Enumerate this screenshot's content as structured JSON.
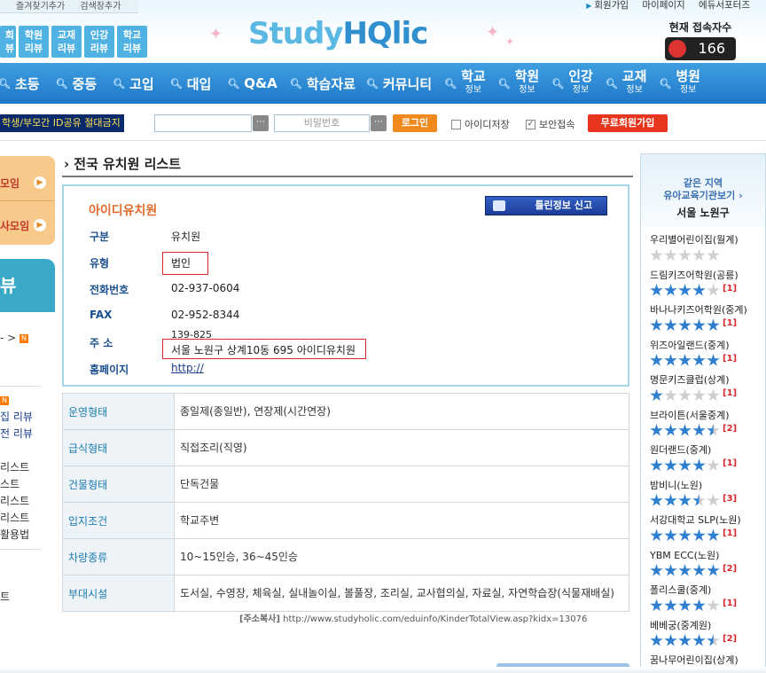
{
  "top_left_links": [
    "즐겨찾기추가",
    "검색창추가"
  ],
  "top_right_links": [
    "회원가입",
    "마이페이지",
    "에듀서포터즈"
  ],
  "mini_tabs": [
    {
      "l1": "회",
      "l2": "뷰"
    },
    {
      "l1": "학원",
      "l2": "리뷰"
    },
    {
      "l1": "교재",
      "l2": "리뷰"
    },
    {
      "l1": "인강",
      "l2": "리뷰"
    },
    {
      "l1": "학교",
      "l2": "리뷰"
    }
  ],
  "logo": {
    "part1": "Study",
    "part2": "HQlic"
  },
  "connected": {
    "label": "현재 접속자수",
    "count": "166"
  },
  "nav": {
    "items": [
      "초등",
      "중등",
      "고입",
      "대입",
      "Q&A",
      "학습자료",
      "커뮤니티"
    ],
    "two_line": [
      {
        "main": "학교",
        "sub": "정보"
      },
      {
        "main": "학원",
        "sub": "정보"
      },
      {
        "main": "인강",
        "sub": "정보"
      },
      {
        "main": "교재",
        "sub": "정보"
      },
      {
        "main": "병원",
        "sub": "정보"
      }
    ]
  },
  "login": {
    "warning": "학생/부모간 ID공유 절대금지",
    "id_placeholder": "",
    "pw_placeholder": "비밀번호",
    "login_btn": "로그인",
    "save_id": "아이디저장",
    "secure": "보안접속",
    "signup_btn": "무료회원가입"
  },
  "left": {
    "box_rows": [
      "모임",
      "사모임"
    ],
    "box2_text": "뷰",
    "list": [
      {
        "text": "- >",
        "blue": false,
        "new": true
      },
      {
        "text": "",
        "blue": false,
        "new": false
      },
      {
        "text": "",
        "blue": false,
        "new": false
      },
      {
        "text": "",
        "blue": false,
        "new": false
      },
      {
        "text": "",
        "blue": false,
        "new": true
      },
      {
        "text": "집 리뷰",
        "blue": true,
        "new": false
      },
      {
        "text": "전 리뷰",
        "blue": true,
        "new": false
      },
      {
        "text": "",
        "blue": true,
        "new": false
      },
      {
        "text": "리스트",
        "blue": false,
        "new": false
      },
      {
        "text": "스트",
        "blue": false,
        "new": false
      },
      {
        "text": "리스트",
        "blue": false,
        "new": false
      },
      {
        "text": "리스트",
        "blue": false,
        "new": false
      },
      {
        "text": "활용법",
        "blue": false,
        "new": false
      }
    ],
    "bottom": "트"
  },
  "page_title": "전국 유치원 리스트",
  "kinder": {
    "name": "아이디유치원",
    "report_btn": "틀린정보 신고",
    "rows": [
      {
        "label": "구분",
        "value": "유치원"
      },
      {
        "label": "유형",
        "value": "법인"
      },
      {
        "label": "전화번호",
        "value": "02-937-0604"
      },
      {
        "label": "FAX",
        "value": "02-952-8344"
      },
      {
        "label": "주 소",
        "zip": "139-825",
        "value": "서울 노원구 상계10동 695 아이디유치원"
      },
      {
        "label": "홈페이지",
        "value": "http://"
      }
    ]
  },
  "details": [
    {
      "label": "운영형태",
      "value": "종일제(종일반), 연장제(시간연장)"
    },
    {
      "label": "급식형태",
      "value": "직접조리(직영)"
    },
    {
      "label": "건물형태",
      "value": "단독건물"
    },
    {
      "label": "입지조건",
      "value": "학교주변"
    },
    {
      "label": "차량종류",
      "value": "10~15인승, 36~45인승"
    },
    {
      "label": "부대시설",
      "value": "도서실, 수영장, 체육실, 실내놀이실, 볼풀장, 조리실, 교사협의실, 자료실, 자연학습장(식물재배실)"
    }
  ],
  "address_copy": {
    "label": "[주소복사]",
    "url": "http://www.studyholic.com/eduinfo/KinderTotalView.asp?kidx=13076"
  },
  "right": {
    "head1": "같은 지역",
    "head2": "유아교육기관보기",
    "region": "서울 노원구",
    "items": [
      {
        "name": "우리별어린이집(월계)",
        "rating": 0,
        "count": ""
      },
      {
        "name": "드림키즈어학원(공릉)",
        "rating": 4,
        "count": "[1]"
      },
      {
        "name": "바나나키즈어학원(중계)",
        "rating": 5,
        "count": "[1]"
      },
      {
        "name": "위즈아일랜드(중계)",
        "rating": 5,
        "count": "[1]"
      },
      {
        "name": "명문키즈클럽(상계)",
        "rating": 1,
        "count": "[1]"
      },
      {
        "name": "브라이튼(서울중계)",
        "rating": 4.5,
        "count": "[2]"
      },
      {
        "name": "원더랜드(중계)",
        "rating": 4,
        "count": "[1]"
      },
      {
        "name": "밤비니(노원)",
        "rating": 3.5,
        "count": "[3]"
      },
      {
        "name": "서강대학교 SLP(노원)",
        "rating": 5,
        "count": "[1]"
      },
      {
        "name": "YBM ECC(노원)",
        "rating": 5,
        "count": "[2]"
      },
      {
        "name": "폴리스쿨(중계)",
        "rating": 4,
        "count": "[1]"
      },
      {
        "name": "베베궁(중계원)",
        "rating": 4.5,
        "count": "[2]"
      },
      {
        "name": "꿈나무어린이집(상계)",
        "rating": 0,
        "count": ""
      }
    ]
  },
  "colors": {
    "accent": "#1f78c9",
    "star_on": "#2f7fd1",
    "star_off": "#cfcfcf",
    "label_blue": "#1a4f8f",
    "name_orange": "#e26a2c"
  }
}
